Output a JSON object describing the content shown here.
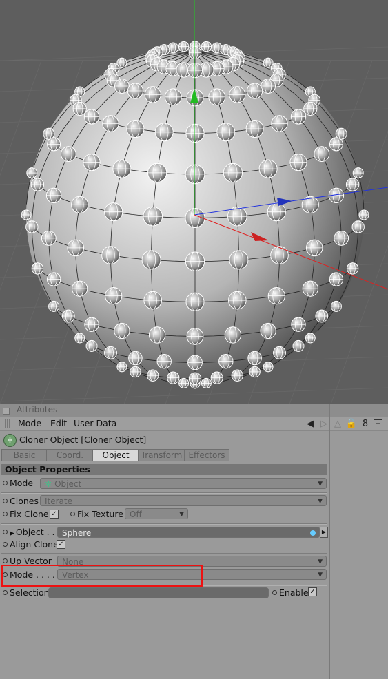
{
  "colors": {
    "accent_red": "#e11111",
    "viewport_bg": "#5e5e5e",
    "panel_bg": "#9a9a9a",
    "axis_y": "#22cc22",
    "axis_x": "#e02020",
    "axis_z": "#2233dd"
  },
  "attributes": {
    "title": "Attributes"
  },
  "menu": {
    "items": [
      "Mode",
      "Edit",
      "User Data"
    ],
    "icons": [
      "back-arrow-icon",
      "forward-arrow-icon",
      "up-arrow-icon",
      "lock-icon",
      "link-icon",
      "new-panel-icon"
    ]
  },
  "object": {
    "icon": "cloner-icon",
    "title": "Cloner Object [Cloner Object]"
  },
  "tabs": [
    "Basic",
    "Coord.",
    "Object",
    "Transform",
    "Effectors"
  ],
  "active_tab": "Object",
  "section": {
    "title": "Object Properties"
  },
  "props": {
    "mode_label": "Mode",
    "mode_value": "Object",
    "clones_label": "Clones",
    "clones_value": "Iterate",
    "fix_clone_label": "Fix Clone",
    "fix_texture_label": "Fix Texture",
    "fix_texture_value": "Off",
    "object_label": "Object . . .",
    "object_value": "Sphere",
    "align_clone_label": "Align Clone",
    "up_vector_label": "Up Vector",
    "up_vector_value": "None",
    "distribution_label": "Mode . . . .",
    "distribution_value": "Vertex",
    "selection_label": "Selection",
    "enable_label": "Enable"
  }
}
